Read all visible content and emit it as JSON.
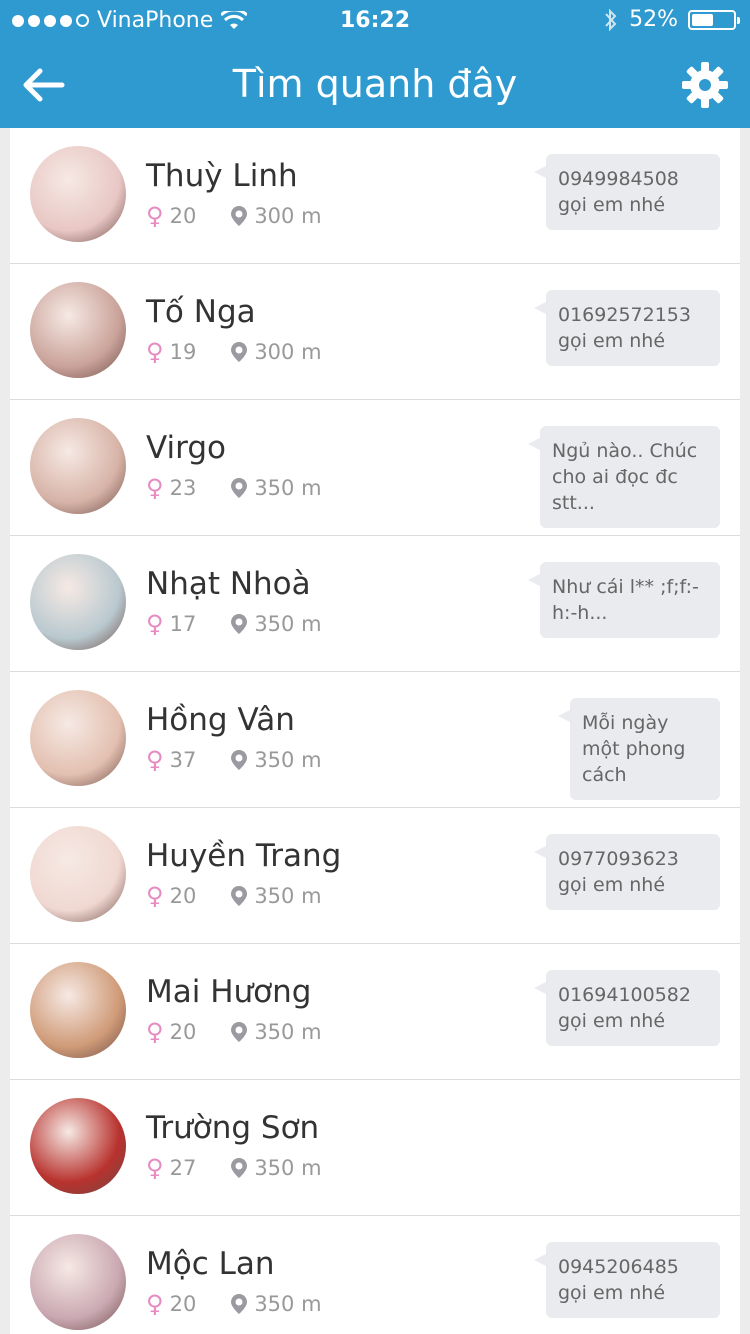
{
  "status_bar": {
    "carrier": "VinaPhone",
    "time": "16:22",
    "battery": "52%",
    "battery_level": 0.52
  },
  "nav": {
    "title": "Tìm quanh đây"
  },
  "people": [
    {
      "name": "Thuỳ Linh",
      "age": "20",
      "distance": "300 m",
      "message": "0949984508 gọi em nhé",
      "avatar_color": "#e8c7c4"
    },
    {
      "name": "Tố Nga",
      "age": "19",
      "distance": "300 m",
      "message": "01692572153 gọi em nhé",
      "avatar_color": "#caa39a"
    },
    {
      "name": "Virgo",
      "age": "23",
      "distance": "350 m",
      "message": "Ngủ nào..  Chúc cho ai đọc đc stt...",
      "avatar_color": "#d7b3a7"
    },
    {
      "name": "Nhạt Nhoà",
      "age": "17",
      "distance": "350 m",
      "message": "Như cái l** ;f;f:-h:-h...",
      "avatar_color": "#b9c9cf"
    },
    {
      "name": "Hồng Vân",
      "age": "37",
      "distance": "350 m",
      "message": "Mỗi ngày một phong cách",
      "avatar_color": "#e3c0b0"
    },
    {
      "name": "Huyền Trang",
      "age": "20",
      "distance": "350 m",
      "message": "0977093623 gọi em nhé",
      "avatar_color": "#f0d8d1"
    },
    {
      "name": "Mai Hương",
      "age": "20",
      "distance": "350 m",
      "message": "01694100582 gọi em nhé",
      "avatar_color": "#d09b78"
    },
    {
      "name": "Trường Sơn",
      "age": "27",
      "distance": "350 m",
      "message": "",
      "avatar_color": "#b8322e"
    },
    {
      "name": "Mộc Lan",
      "age": "20",
      "distance": "350 m",
      "message": "0945206485 gọi em nhé",
      "avatar_color": "#caa8b2"
    }
  ]
}
